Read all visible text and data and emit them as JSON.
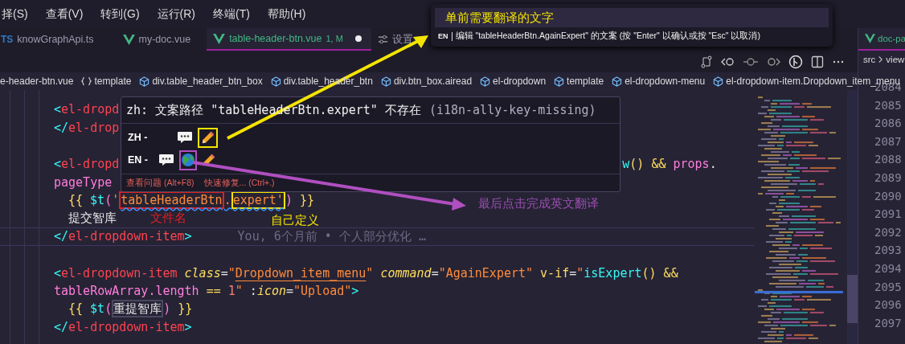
{
  "menu": [
    "择(S)",
    "查看(V)",
    "转到(G)",
    "运行(R)",
    "终端(T)",
    "帮助(H)"
  ],
  "tabs": [
    {
      "label": "knowGraphApi.ts",
      "kind": "ts",
      "icon_text": "TS",
      "selected": false,
      "modified": false
    },
    {
      "label": "my-doc.vue",
      "kind": "vue",
      "selected": false,
      "modified": false
    },
    {
      "label": "table-header-btn.vue",
      "kind": "vue",
      "badge": "1, M",
      "selected": true,
      "modified": true
    },
    {
      "label": "设置",
      "kind": "settings",
      "selected": false,
      "modified": false
    }
  ],
  "breadcrumb": [
    {
      "label": "e-header-btn.vue",
      "kind": "file"
    },
    {
      "label": "template",
      "kind": "braces"
    },
    {
      "label": "div.table_header_btn_box",
      "kind": "element"
    },
    {
      "label": "div.table_header_btn",
      "kind": "element"
    },
    {
      "label": "div.btn_box.airead",
      "kind": "element"
    },
    {
      "label": "el-dropdown",
      "kind": "element"
    },
    {
      "label": "template",
      "kind": "element"
    },
    {
      "label": "el-dropdown-menu",
      "kind": "element"
    },
    {
      "label": "el-dropdown-item.Dropdown_item_menu",
      "kind": "element"
    }
  ],
  "code_lines": [
    {
      "indented": false,
      "current": false,
      "tokens": [
        {
          "text": "<",
          "kind": "punct"
        },
        {
          "text": "el-dropd",
          "kind": "tag"
        }
      ]
    },
    {
      "indented": false,
      "current": false,
      "tokens": [
        {
          "text": "</",
          "kind": "punct"
        },
        {
          "text": "el-drop",
          "kind": "tag"
        }
      ]
    },
    {
      "current": false
    },
    {
      "indented": false,
      "current": false,
      "tokens": [
        {
          "text": "<",
          "kind": "punct"
        },
        {
          "text": "el-dropd",
          "kind": "tag"
        }
      ],
      "tail_tokens": [
        {
          "text": "w",
          "kind": "fn"
        },
        {
          "text": "() && ",
          "kind": "brace"
        },
        {
          "text": "props",
          "kind": "var"
        },
        {
          "text": ".",
          "kind": "op"
        }
      ]
    },
    {
      "indented": false,
      "current": false,
      "tokens": [
        {
          "text": "pageType",
          "kind": "var"
        }
      ]
    },
    {
      "indented": true,
      "current": false,
      "tokens": [
        {
          "text": "{{ ",
          "kind": "brace"
        },
        {
          "text": "$t",
          "kind": "fn"
        },
        {
          "text": "(",
          "kind": "paren"
        },
        {
          "text": "'",
          "kind": "string"
        },
        {
          "text": "tableHeaderBtn",
          "kind": "string",
          "squiggle": true,
          "color": "#e02020"
        },
        {
          "text": ".",
          "kind": "string",
          "squiggle": true
        },
        {
          "text": "expert'",
          "kind": "string",
          "squiggle": true,
          "color": "#f5e400"
        },
        {
          "text": ") ",
          "kind": "paren"
        },
        {
          "text": "}}",
          "kind": "brace"
        }
      ]
    },
    {
      "indented": true,
      "current": false,
      "tokens": [
        {
          "text": "提交智库",
          "kind": "text"
        }
      ]
    },
    {
      "indented": false,
      "current": true,
      "tokens": [
        {
          "text": "</",
          "kind": "punct"
        },
        {
          "text": "el-dropdown-item",
          "kind": "tag"
        },
        {
          "text": ">",
          "kind": "punct"
        }
      ],
      "blame": "You, 6个月前 • 个人部分优化 …"
    },
    {
      "current": false
    },
    {
      "indented": false,
      "current": false,
      "tokens": [
        {
          "text": "<",
          "kind": "punct"
        },
        {
          "text": "el-dropdown-item",
          "kind": "tag"
        },
        {
          "text": " class",
          "kind": "attr"
        },
        {
          "text": "=",
          "kind": "op"
        },
        {
          "text": "\"",
          "kind": "string"
        },
        {
          "text": "Dropdown_item_menu",
          "kind": "string",
          "underline": true
        },
        {
          "text": "\"",
          "kind": "string"
        },
        {
          "text": " command",
          "kind": "attr"
        },
        {
          "text": "=",
          "kind": "op"
        },
        {
          "text": "\"AgainExpert\"",
          "kind": "string"
        },
        {
          "text": " v-if",
          "kind": "directive"
        },
        {
          "text": "=",
          "kind": "op"
        },
        {
          "text": "\"",
          "kind": "string"
        },
        {
          "text": "isExpert",
          "kind": "fn"
        },
        {
          "text": "()",
          "kind": "brace"
        },
        {
          "text": " &&",
          "kind": "brace"
        }
      ]
    },
    {
      "indented": false,
      "current": false,
      "tokens": [
        {
          "text": "tableRowArray.length",
          "kind": "var"
        },
        {
          "text": " == ",
          "kind": "brace"
        },
        {
          "text": "1",
          "kind": "number"
        },
        {
          "text": "\"",
          "kind": "string"
        },
        {
          "text": " :",
          "kind": "op"
        },
        {
          "text": "icon",
          "kind": "attr"
        },
        {
          "text": "=",
          "kind": "op"
        },
        {
          "text": "\"Upload\"",
          "kind": "string"
        },
        {
          "text": ">",
          "kind": "punct"
        }
      ]
    },
    {
      "indented": true,
      "current": false,
      "tokens": [
        {
          "text": "{{ ",
          "kind": "brace"
        },
        {
          "text": "$t",
          "kind": "fn"
        },
        {
          "text": "(",
          "kind": "paren"
        },
        {
          "text": "重提智库",
          "kind": "text",
          "color": "#4a4760"
        },
        {
          "text": ") ",
          "kind": "paren"
        },
        {
          "text": "}}",
          "kind": "brace"
        }
      ]
    },
    {
      "indented": false,
      "current": false,
      "tokens": [
        {
          "text": "</",
          "kind": "punct"
        },
        {
          "text": "el-dropdown-item",
          "kind": "tag"
        },
        {
          "text": ">",
          "kind": "punct"
        }
      ]
    }
  ],
  "hover": {
    "message": "zh: 文案路径 \"tableHeaderBtn.expert\" 不存在",
    "source": "(i18n-ally-key-missing)",
    "locales": [
      {
        "label": "ZH -",
        "actions": [
          {
            "kind": "comment"
          },
          {
            "kind": "edit",
            "color": "#f5e400"
          }
        ]
      },
      {
        "label": "EN -",
        "actions": [
          {
            "kind": "comment"
          },
          {
            "kind": "translate",
            "color": "#b04fc0"
          },
          {
            "kind": "edit"
          }
        ]
      }
    ],
    "links": [
      "查看问题 (Alt+F8)",
      "快速修复... (Ctrl+.)"
    ]
  },
  "quick_input": {
    "value": "单前需要翻译的文字",
    "locale": "EN",
    "hint": "编辑 \"tableHeaderBtn.AgainExpert\" 的文案 (按 \"Enter\" 以确认或按 \"Esc\" 以取消)"
  },
  "annotations": [
    {
      "text": "文件名",
      "color": "#e02020"
    },
    {
      "text": "自己定义",
      "color": "#f5e400"
    },
    {
      "text": "最后点击完成英文翻译",
      "color": "#9b4fb0"
    }
  ],
  "arrows": [
    {
      "color": "#f5e400"
    },
    {
      "color": "#b04fc0"
    }
  ],
  "right_group": {
    "tab": "doc-pa",
    "breadcrumb": [
      "src",
      "view"
    ],
    "line_numbers": [
      "2084",
      "2085",
      "2086",
      "2087",
      "2088",
      "2089",
      "2090",
      "2091",
      "2092",
      "2093",
      "2094",
      "2095",
      "2096",
      "2097"
    ]
  }
}
